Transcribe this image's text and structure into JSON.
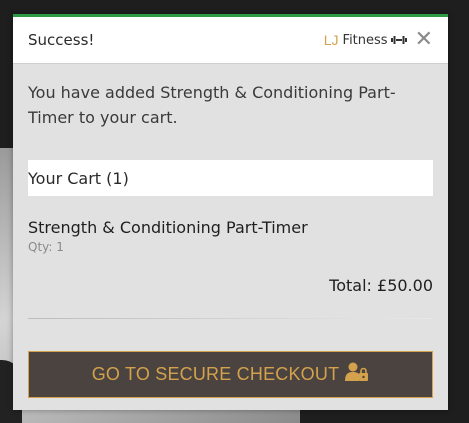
{
  "modal": {
    "title": "Success!",
    "brand_prefix": "LJ",
    "brand_name": "Fitness",
    "close_label": "✕",
    "message": "You have added Strength & Conditioning Part-Timer to your cart."
  },
  "cart": {
    "header": "Your Cart (1)",
    "item_name": "Strength & Conditioning Part-Timer",
    "item_qty": "Qty: 1",
    "total": "Total: £50.00"
  },
  "checkout": {
    "label": "GO TO SECURE CHECKOUT",
    "icon": "user-lock-icon"
  },
  "colors": {
    "accent_gold": "#d4a24c",
    "success_green": "#2e9b44",
    "button_bg": "#4a4340"
  }
}
